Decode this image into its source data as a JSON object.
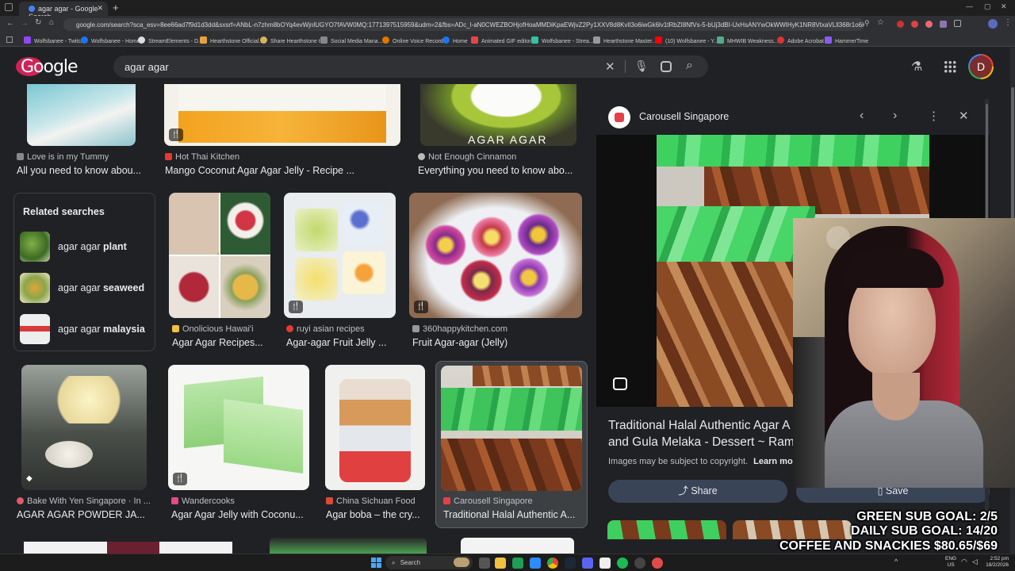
{
  "browser": {
    "tab_title": "agar agar - Google Search",
    "new_tab_symbol": "+",
    "url": "google.com/search?sca_esv=8ee66ad7f9d1d3dd&sxsrf=ANbL-n7zhm8bOYq4evWjnlUGYO7fAVW0MQ:1771397515959&udm=2&fbs=ADc_l-aN0CWEZBOHjofHoaMMDiKpaEWjvZ2Py1XXV8d8KvlI3o6iwGk6lv1tRbZI8NfVs-5-bUj3dBI-UxHsANYwOkWWIHyK1NR8VtxaVLll368r1o6iGYaS4PFE4_J9pFcEtDh70qzaV0FIksDghnC",
    "bookmarks": [
      "Wolfsbanee - Twitch",
      "Wolfsbanee - Home",
      "StreamElements - D...",
      "Hearthstone Official...",
      "Share Hearthstone to...",
      "Social Media Mana...",
      "Online Voice Record...",
      "Home",
      "Animated GIF editor...",
      "Wolfsbanee - Strea...",
      "Hearthstone Master...",
      "(10) Wolfsbanee - Y...",
      "MHWIB Weakness...",
      "Adobe Acrobat",
      "HammerTime"
    ]
  },
  "google": {
    "logo": "Google",
    "query": "agar agar",
    "avatar_letter": "D"
  },
  "results_row1": [
    {
      "source": "Love is in my Tummy",
      "title": "All you need to know abou..."
    },
    {
      "source": "Hot Thai Kitchen",
      "title": "Mango Coconut Agar Agar Jelly - Recipe ..."
    },
    {
      "source": "Not Enough Cinnamon",
      "title": "Everything you need to know abo..."
    }
  ],
  "thumb_overlay_text": "AGAR AGAR",
  "related": {
    "heading": "Related searches",
    "items": [
      {
        "prefix": "agar agar ",
        "bold": "plant"
      },
      {
        "prefix": "agar agar ",
        "bold": "seaweed"
      },
      {
        "prefix": "agar agar ",
        "bold": "malaysia"
      }
    ]
  },
  "results_row2": [
    {
      "source": "Onolicious Hawai'i",
      "title": "Agar Agar Recipes..."
    },
    {
      "source": "ruyi asian recipes",
      "title": "Agar-agar Fruit Jelly ..."
    },
    {
      "source": "360happykitchen.com",
      "title": "Fruit Agar-agar (Jelly)"
    }
  ],
  "results_row3": [
    {
      "source": "Bake With Yen Singapore · In ...",
      "title": "AGAR AGAR POWDER JA..."
    },
    {
      "source": "Wandercooks",
      "title": "Agar Agar Jelly with Coconu..."
    },
    {
      "source": "China Sichuan Food",
      "title": "Agar boba – the cry..."
    },
    {
      "source": "Carousell Singapore",
      "title": "Traditional Halal Authentic A..."
    }
  ],
  "panel": {
    "source": "Carousell Singapore",
    "title_line1": "Traditional Halal Authentic Agar A",
    "title_line2": "and Gula Melaka - Dessert ~ Ram",
    "copyright": "Images may be subject to copyright.",
    "learn_more": "Learn more",
    "share": "Share",
    "save": "Save"
  },
  "stream_overlay": {
    "goal1": "GREEN SUB GOAL: 2/5",
    "goal2": "DAILY SUB GOAL: 14/20",
    "goal3": "COFFEE AND SNACKIES $80.65/$69"
  },
  "taskbar": {
    "search": "Search",
    "lang": "ENG",
    "region": "US",
    "time": "2:52 pm",
    "date": "18/2/2026"
  }
}
